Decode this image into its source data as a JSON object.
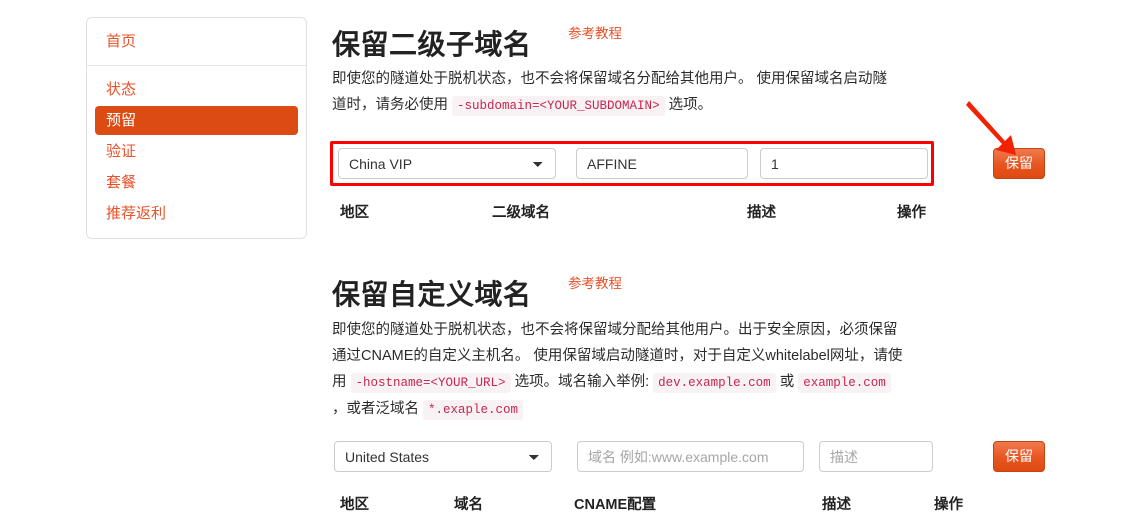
{
  "sidebar": {
    "home": {
      "label": "首页"
    },
    "items": [
      {
        "label": "状态",
        "active": false
      },
      {
        "label": "预留",
        "active": true
      },
      {
        "label": "验证",
        "active": false
      },
      {
        "label": "套餐",
        "active": false
      },
      {
        "label": "推荐返利",
        "active": false
      }
    ]
  },
  "section1": {
    "title": "保留二级子域名",
    "link": "参考教程",
    "desc_a": "即使您的隧道处于脱机状态，也不会将保留域名分配给其他用户。 使用保留域名启动隧道时，请务必使用",
    "desc_code": "-subdomain=<YOUR_SUBDOMAIN>",
    "desc_b": "选项。",
    "form": {
      "region_value": "China VIP",
      "region_options": [
        "China VIP",
        "United States"
      ],
      "subdomain_value": "AFFINE",
      "subdomain_placeholder": "二级域名",
      "desc_value": "1",
      "desc_placeholder": "描述",
      "save_label": "保留"
    },
    "table_headers": [
      "地区",
      "二级域名",
      "描述",
      "操作"
    ]
  },
  "section2": {
    "title": "保留自定义域名",
    "link": "参考教程",
    "desc_a": "即使您的隧道处于脱机状态，也不会将保留域分配给其他用户。出于安全原因，必须保留通过CNAME的自定义主机名。 使用保留域启动隧道时，对于自定义whitelabel网址，请使用",
    "desc_code1": "-hostname=<YOUR_URL>",
    "desc_b": "选项。域名输入举例:",
    "desc_code2": "dev.example.com",
    "desc_c": "或",
    "desc_code3": "example.com",
    "desc_d": "，或者泛域名",
    "desc_code4": "*.exaple.com",
    "form": {
      "region_value": "United States",
      "region_options": [
        "United States",
        "China VIP"
      ],
      "domain_value": "",
      "domain_placeholder": "域名 例如:www.example.com",
      "desc_value": "",
      "desc_placeholder": "描述",
      "save_label": "保留"
    },
    "table_headers": [
      "地区",
      "域名",
      "CNAME配置",
      "描述",
      "操作"
    ]
  },
  "annotations": {
    "highlight_color": "#ff0000",
    "arrow_color": "#f42100",
    "accent_color": "#e8512a",
    "active_bg": "#dd4b14"
  }
}
